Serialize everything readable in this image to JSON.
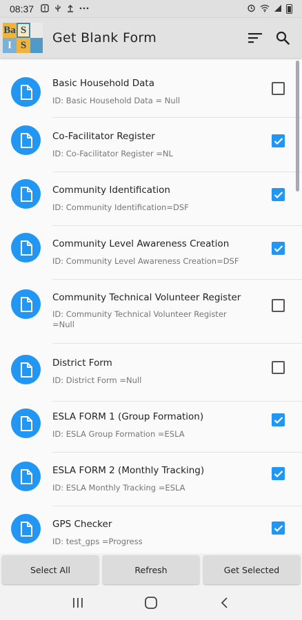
{
  "status_bar": {
    "time": "08:37",
    "left_icons": [
      "alert-icon",
      "usb-icon",
      "upload-icon",
      "more-icon"
    ],
    "right_icons": [
      "alarm-icon",
      "wifi-icon",
      "signal-icon",
      "battery-icon"
    ]
  },
  "app_bar": {
    "title": "Get Blank Form",
    "logo_letters": [
      "Ba",
      "S",
      "",
      "I",
      "S",
      ""
    ],
    "actions": [
      "sort-icon",
      "search-icon"
    ]
  },
  "forms": [
    {
      "name": "Basic Household Data",
      "id_line": "ID: Basic Household Data = Null",
      "checked": false
    },
    {
      "name": "Co-Facilitator Register",
      "id_line": "ID: Co-Facilitator Register =NL",
      "checked": true
    },
    {
      "name": "Community Identification",
      "id_line": "ID: Community Identification=DSF",
      "checked": true
    },
    {
      "name": "Community Level Awareness Creation",
      "id_line": "ID: Community Level Awareness Creation=DSF",
      "checked": true
    },
    {
      "name": "Community Technical Volunteer  Register",
      "id_line": "ID: Community Technical Volunteer  Register =Null",
      "checked": false
    },
    {
      "name": "District Form",
      "id_line": "ID: District Form =Null",
      "checked": false
    },
    {
      "name": "ESLA FORM 1 (Group Formation)",
      "id_line": "ID: ESLA Group Formation =ESLA",
      "checked": true
    },
    {
      "name": "ESLA FORM 2 (Monthly Tracking)",
      "id_line": "ID: ESLA Monthly Tracking =ESLA",
      "checked": true
    },
    {
      "name": "GPS Checker",
      "id_line": "ID: test_gps =Progress",
      "checked": true
    }
  ],
  "buttons": {
    "select_all": "Select All",
    "refresh": "Refresh",
    "get_selected": "Get Selected"
  },
  "nav": [
    "recents-icon",
    "home-icon",
    "back-icon"
  ],
  "colors": {
    "accent": "#2196f3",
    "app_bar": "#e2e2e2",
    "status_bar": "#e0e0e0"
  }
}
